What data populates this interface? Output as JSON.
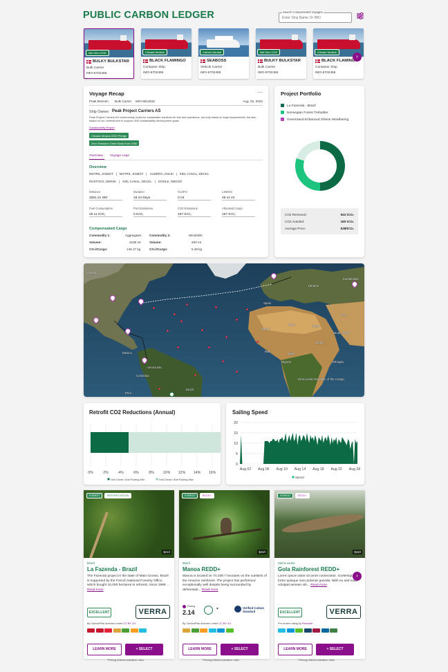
{
  "header": {
    "title": "PUBLIC CARBON LEDGER",
    "search_label": "Search Compensated Voyages",
    "search_placeholder": "Enter Ship Name Or IMO"
  },
  "ships": [
    {
      "badge": "Net Zero GHG",
      "name": "BULKY BULKSTAR",
      "type": "Bulk Carrier",
      "imo": "IMO-6702455",
      "img": "tanker"
    },
    {
      "badge": "Climate Neutral",
      "name": "BLACK FLAMINGO",
      "type": "Container Ship",
      "imo": "IMO-6702455",
      "img": "tanker"
    },
    {
      "badge": "Carbon Neutral",
      "name": "SEABOSS",
      "type": "Vehicle Carrier",
      "imo": "IMO-6702455",
      "img": "cruise"
    },
    {
      "badge": "Net Zero CO2",
      "name": "BULKY BULKSTAR",
      "type": "Bulk Carrier",
      "imo": "IMO-6702455",
      "img": "tanker"
    },
    {
      "badge": "Climate Neutral",
      "name": "BLACK FLAMINGO",
      "type": "Container Ship",
      "imo": "IMO-6702455",
      "img": "tanker"
    }
  ],
  "voyage": {
    "heading": "Voyage Recap",
    "ship_name": "Peak Bremen",
    "ship_type": "Bulk Carrier",
    "imo": "IMO-9612532",
    "date": "Aug. 02, 2022",
    "owner_label": "Ship Owner:",
    "owner": "Peak Project Carriers AS",
    "owner_desc": "Peak Project Carriers AS continuously works for sustainable solutions for fuel and operations, not only based on legal requirements, but also based on our commitment to support UNS sustainability development goals.",
    "report_link": "Sustainability Report",
    "badges": [
      "Climate Neutral 2030 Pledge",
      "Zero Emission Order Book from 2030"
    ],
    "tabs": [
      "Overview",
      "Voyage Legs"
    ],
    "overview_heading": "Overview",
    "route_1": [
      "MOTRIL, ESMOT",
      "MOTRIL, ESMOT",
      "ALMERIA, ESLEI",
      "KIEL CANAL, DECKL"
    ],
    "route_2": [
      "ROSTOCK, DERSK",
      "KIEL CANAL, DECKL",
      "GOOLE, GBGOO"
    ],
    "fields_1": [
      {
        "k": "Distance",
        "v": "2581.21 NM"
      },
      {
        "k": "Duration",
        "v": "16.44 Days"
      },
      {
        "k": "VLSFO",
        "v": "0 mt"
      },
      {
        "k": "LSMGO",
        "v": "49.11 mt"
      }
    ],
    "fields_2": [
      {
        "k": "Fuel Consumption",
        "v": "49.11 tCO₂"
      },
      {
        "k": "Port Emissions",
        "v": "0 tCO₂"
      },
      {
        "k": "CO2 Emissions",
        "v": "157 tCO₂"
      },
      {
        "k": "Allocated Cargo",
        "v": "157 tCO₂"
      }
    ],
    "cargo_heading": "Compensated Cargo",
    "cargo": {
      "c1_label": "Commodity 1:",
      "c1": "Aggregates",
      "c2_label": "Commodity 2:",
      "c2": "Windmills",
      "vol_label": "Volume:",
      "vol1": "3195 mt",
      "vol2": "200 mt",
      "co2_label": "CO₂/tCargo:",
      "co2_1": "148.17 kg",
      "co2_2": "5.28 kg"
    }
  },
  "portfolio": {
    "heading": "Project Portfolio",
    "items": [
      {
        "name": "La Fazenda - Brazil",
        "color": "#0c6b45"
      },
      {
        "name": "Norwegian Forest Trefadder",
        "color": "#1cc47f"
      },
      {
        "name": "GreenSand Enhanced Olivine Weathering",
        "color": "#b73fb7"
      }
    ],
    "donut_values": [
      0.5,
      0.3,
      0.2
    ],
    "summary": [
      {
        "k": "CO2 Removed:",
        "v": "943 tCO₂"
      },
      {
        "k": "CO2 Avoided:",
        "v": "180 tCO₂"
      },
      {
        "k": "Average Price:",
        "v": "$38/tCO₂"
      }
    ]
  },
  "map": {
    "labels": [
      "Canada",
      "Mexico",
      "Venezuela",
      "Colombia",
      "Brazil",
      "Peru",
      "Algeria",
      "Niger",
      "Sudan",
      "Egypt",
      "Libya",
      "Mali",
      "Nigeria",
      "Ukraine",
      "Spain",
      "Kazakhstan",
      "Iran",
      "Saudi Arabia",
      "Ethiopia",
      "Democratic Republic of the Congo"
    ]
  },
  "chart_data": [
    {
      "type": "bar",
      "title": "Retrofit CO2 Reductions (Annual)",
      "orientation": "horizontal",
      "stacked": true,
      "series": [
        {
          "name": "Hull Clean / Anti Fouling Min",
          "values": [
            5
          ],
          "color": "#0c6b45"
        },
        {
          "name": "Hull Clean / Anti Fouling Max",
          "values": [
            15
          ],
          "color": "#cfe6dc"
        }
      ],
      "x_ticks": [
        "0%",
        "2%",
        "4%",
        "6%",
        "8%",
        "10%",
        "12%",
        "14%",
        "16%"
      ],
      "xlim": [
        0,
        16
      ]
    },
    {
      "type": "area",
      "title": "Sailing Speed",
      "series": [
        {
          "name": "Speed",
          "color": "#0c6b45"
        }
      ],
      "x_ticks": [
        "Aug 02",
        "Aug 06",
        "Aug 10",
        "Aug 14",
        "Aug 18",
        "Aug 22",
        "Aug 28"
      ],
      "y_ticks": [
        0,
        5,
        10,
        15,
        20
      ],
      "ylim": [
        0,
        20
      ],
      "values": [
        0,
        14,
        0,
        0,
        0,
        0,
        0,
        0,
        0,
        0,
        0,
        0,
        0,
        0,
        0,
        0,
        0,
        0,
        0,
        0,
        0,
        11,
        11,
        11,
        11,
        10,
        11,
        11,
        12,
        12,
        11,
        11,
        12,
        10,
        12,
        12,
        13,
        11,
        12,
        15,
        10,
        12,
        14,
        11,
        13,
        15,
        11,
        12,
        15,
        9,
        13,
        14,
        11,
        12,
        14,
        13,
        11,
        15,
        12,
        10,
        14,
        12,
        13,
        11,
        14,
        12,
        9,
        13,
        12,
        11,
        14,
        10,
        12,
        13,
        11,
        14,
        12,
        9,
        13,
        10,
        12,
        11,
        13,
        9,
        12,
        11,
        10,
        13,
        12,
        11,
        10,
        9,
        12,
        11,
        7,
        10,
        11,
        0,
        12,
        10,
        11
      ]
    }
  ],
  "projects": [
    {
      "tags": [
        {
          "t": "FOREST",
          "c": "#2e8b57"
        },
        {
          "t": "REFORESTATION",
          "c": "#2e8b57"
        }
      ],
      "price": "$21/t",
      "location": "Brazil",
      "name": "La Fazenda - Brazil",
      "desc": "The Fazenda project in the state of Mato Grosso, Brazil is supported by the French National Forestry Office, which bought 10,000 hectares to reforest. Since 1999 ...",
      "more": "Read more",
      "rating": "EXCELLENT",
      "by": "By CarbonPlan licensed under",
      "by_link": "CC BY 4.0",
      "standard": "VERRA",
      "learn": "LEARN MORE",
      "select": "SELECT",
      "note": "*Pricing reflects indicative rates"
    },
    {
      "tags": [
        {
          "t": "FOREST",
          "c": "#2e8b57"
        },
        {
          "t": "REDD+",
          "c": "#b73fb7"
        }
      ],
      "price": "$20/t",
      "location": "Brazil",
      "name": "Manoa REDD+",
      "desc": "Manoa is located on 74,038.7 hectares on the outskirts of the Amazon rainforest. The project has performed exceptionally well despite being surrounded by deforestati...",
      "more": "Read more",
      "rating_label": "Rating",
      "rating_value": "2.14",
      "by": "By CarbonPlan licensed under",
      "by_link": "CC BY 4.0",
      "standard": "Verified Carbon Standard",
      "learn": "LEARN MORE",
      "select": "SELECT",
      "note": "*Pricing reflects indicative rates"
    },
    {
      "tags": [
        {
          "t": "FOREST",
          "c": "#2e8b57"
        },
        {
          "t": "REDD+",
          "c": "#b73fb7"
        }
      ],
      "price": "$16/t",
      "location": "Sierra Leone",
      "name": "Gola Rainforest REDD+",
      "desc": "Lorem ipsum dolor sit amet consectetur. Scelerisque in tortor quisque nam pulvinar gravida. Nibh eu sed nulla volutpat aenean nib...",
      "more": "Read more",
      "rating": "EXCELLENT",
      "by": "Pre-review rating by",
      "by_link": "Renoster",
      "standard": "VERRA",
      "learn": "LEARN MORE",
      "select": "SELECT",
      "note": "*Pricing reflects indicative rates"
    }
  ]
}
